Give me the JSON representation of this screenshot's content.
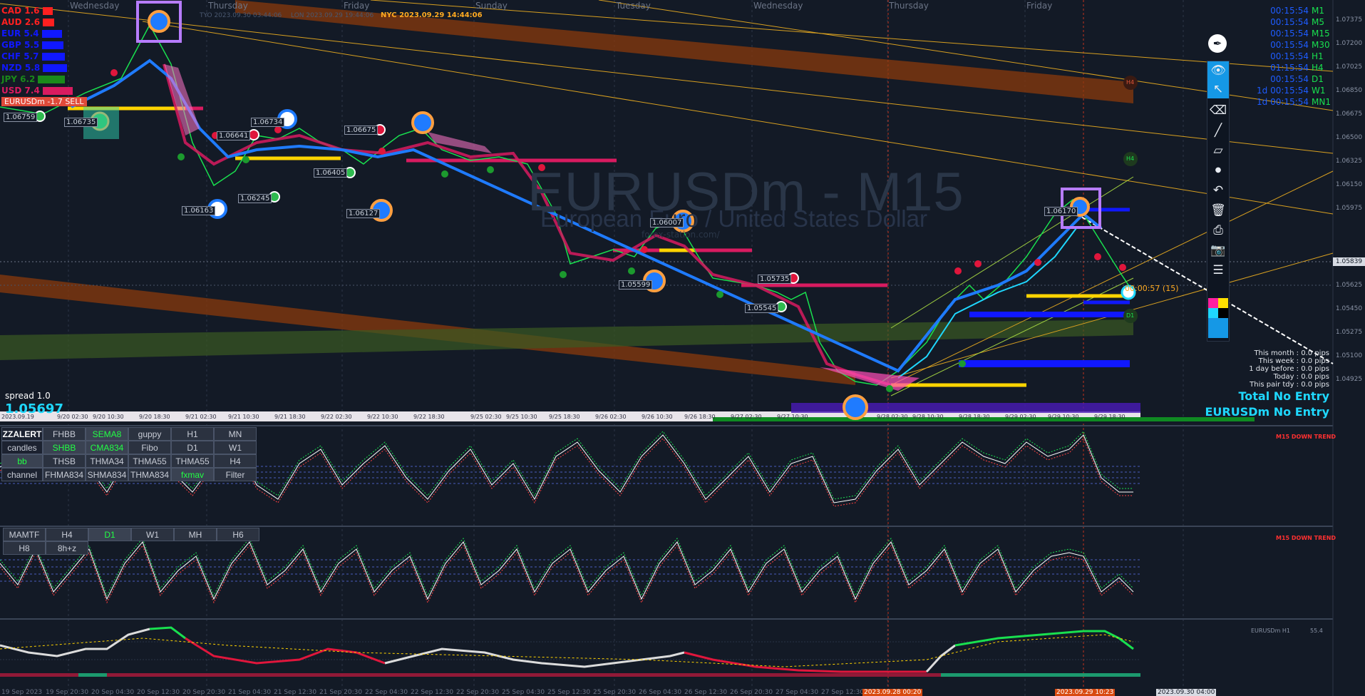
{
  "symbol": {
    "name": "EURUSDm - M15",
    "description": "European Euro / United States Dollar",
    "watermark_url": "forex-station.com/"
  },
  "days": [
    "Wednesday",
    "Thursday",
    "Friday",
    "Sunday",
    "Tuesday",
    "Wednesday",
    "Thursday",
    "Friday"
  ],
  "sessions": {
    "tyo": "TYO 2023.09.30 03:44:06",
    "lon": "LON 2023.09.29 19:44:06",
    "nyc": "NYC 2023.09.29 14:44:06"
  },
  "currency_strength": [
    {
      "ccy": "CAD",
      "value": "1.6",
      "color": "#ff2020"
    },
    {
      "ccy": "AUD",
      "value": "2.6",
      "color": "#ff2020"
    },
    {
      "ccy": "EUR",
      "value": "5.4",
      "color": "#1018ff"
    },
    {
      "ccy": "GBP",
      "value": "5.5",
      "color": "#1018ff"
    },
    {
      "ccy": "CHF",
      "value": "5.7",
      "color": "#1018ff"
    },
    {
      "ccy": "NZD",
      "value": "5.8",
      "color": "#1018ff"
    },
    {
      "ccy": "JPY",
      "value": "6.2",
      "color": "#1a8a1a"
    },
    {
      "ccy": "USD",
      "value": "7.4",
      "color": "#d81b60"
    }
  ],
  "signal_label": "EURUSDm -1.7 SELL",
  "spread": "spread 1.0",
  "bid_price": "1.05697",
  "timeframes": [
    {
      "time": "00:15:54",
      "tf": "M1"
    },
    {
      "time": "00:15:54",
      "tf": "M5"
    },
    {
      "time": "00:15:54",
      "tf": "M15"
    },
    {
      "time": "00:15:54",
      "tf": "M30"
    },
    {
      "time": "00:15:54",
      "tf": "H1"
    },
    {
      "time": "01:15:54",
      "tf": "H4"
    },
    {
      "time": "00:15:54",
      "tf": "D1"
    },
    {
      "time": "1d 00:15:54",
      "tf": "W1"
    },
    {
      "time": "1d 00:15:54",
      "tf": "MN1"
    }
  ],
  "price_labels": [
    {
      "text": "1.06759"
    },
    {
      "text": "1.06735"
    },
    {
      "text": "1.06641"
    },
    {
      "text": "1.06734"
    },
    {
      "text": "1.06675"
    },
    {
      "text": "1.06405"
    },
    {
      "text": "1.06163"
    },
    {
      "text": "1.06245"
    },
    {
      "text": "1.06127"
    },
    {
      "text": "1.06007"
    },
    {
      "text": "1.05599"
    },
    {
      "text": "1.05735"
    },
    {
      "text": "1.05545"
    },
    {
      "text": "1.06170"
    }
  ],
  "countdown": "00:00:57 (15)",
  "price_axis": [
    "1.07375",
    "1.07200",
    "1.07025",
    "1.06850",
    "1.06675",
    "1.06500",
    "1.06325",
    "1.06150",
    "1.05975",
    "1.05839",
    "1.05625",
    "1.05450",
    "1.05275",
    "1.05100",
    "1.04925"
  ],
  "current_price": "1.05839",
  "pip_stats": [
    "This month : 0.0 pips",
    "This week : 0.0 pips",
    "1 day before : 0.0 pips",
    "Today : 0.0 pips",
    "This pair tdy : 0.0 pips"
  ],
  "entry_labels": [
    "Total No Entry",
    "EURUSDm No Entry"
  ],
  "date_strip": [
    "2023.09.19",
    "9/20 02:30",
    "9/20 10:30",
    "9/20 18:30",
    "9/21 02:30",
    "9/21 10:30",
    "9/21 18:30",
    "9/22 02:30",
    "9/22 10:30",
    "9/22 18:30",
    "9/25 02:30",
    "9/25 10:30",
    "9/25 18:30",
    "9/26 02:30",
    "9/26 10:30",
    "9/26 18:30",
    "9/27 02:30",
    "9/27 10:30",
    "9/28 02:30",
    "9/28 10:30",
    "9/28 18:30",
    "9/29 02:30",
    "9/29 10:30",
    "9/29 18:30"
  ],
  "toolbar": {
    "items": [
      "pen-logo",
      "eye",
      "cursor",
      "eraser",
      "line",
      "ruler",
      "dot",
      "undo",
      "trash",
      "printer",
      "camera",
      "notes"
    ]
  },
  "button_panel_1": {
    "rows": [
      [
        "ZZALERT",
        "FHBB",
        "SEMA8",
        "guppy",
        "H1",
        "MN"
      ],
      [
        "candles",
        "SHBB",
        "CMA834",
        "Fibo",
        "D1",
        "W1"
      ],
      [
        "bb",
        "THSB",
        "THMA34",
        "THMA55",
        "THMA55",
        "H4"
      ],
      [
        "channel",
        "FHMA834",
        "SHMA834",
        "THMA834",
        "fxmav",
        "Filter"
      ]
    ],
    "active": [
      "SEMA8",
      "SHBB",
      "CMA834",
      "bb",
      "fxmav"
    ]
  },
  "button_panel_2": {
    "rows": [
      [
        "MAMTF",
        "H4",
        "D1",
        "W1",
        "MH",
        "H6"
      ],
      [
        "H8",
        "8h+z",
        "",
        "",
        "",
        ""
      ]
    ],
    "active": [
      "D1"
    ]
  },
  "panel_titles": [
    "M15 DOWN TREND",
    "M15 DOWN TREND"
  ],
  "bottom_panel_info": {
    "label": "EURUSDm H1",
    "value": "55.4"
  },
  "time_axis": [
    "19 Sep 2023",
    "19 Sep 20:30",
    "20 Sep 04:30",
    "20 Sep 12:30",
    "20 Sep 20:30",
    "21 Sep 04:30",
    "21 Sep 12:30",
    "21 Sep 20:30",
    "22 Sep 04:30",
    "22 Sep 12:30",
    "22 Sep 20:30",
    "25 Sep 04:30",
    "25 Sep 12:30",
    "25 Sep 20:30",
    "26 Sep 04:30",
    "26 Sep 12:30",
    "26 Sep 20:30",
    "27 Sep 04:30",
    "27 Sep 12:30"
  ],
  "time_highlights": [
    "2023.09.28 00:20",
    "2023.09.29 10:23",
    "2023.09.30 04:00"
  ],
  "colors": {
    "background": "#131a26",
    "channel": "#b84a10",
    "bull": "#19e04f",
    "bear": "#d81b60",
    "yellow": "#ffd400",
    "blue": "#1018ff",
    "cyan": "#1fd8ff"
  }
}
